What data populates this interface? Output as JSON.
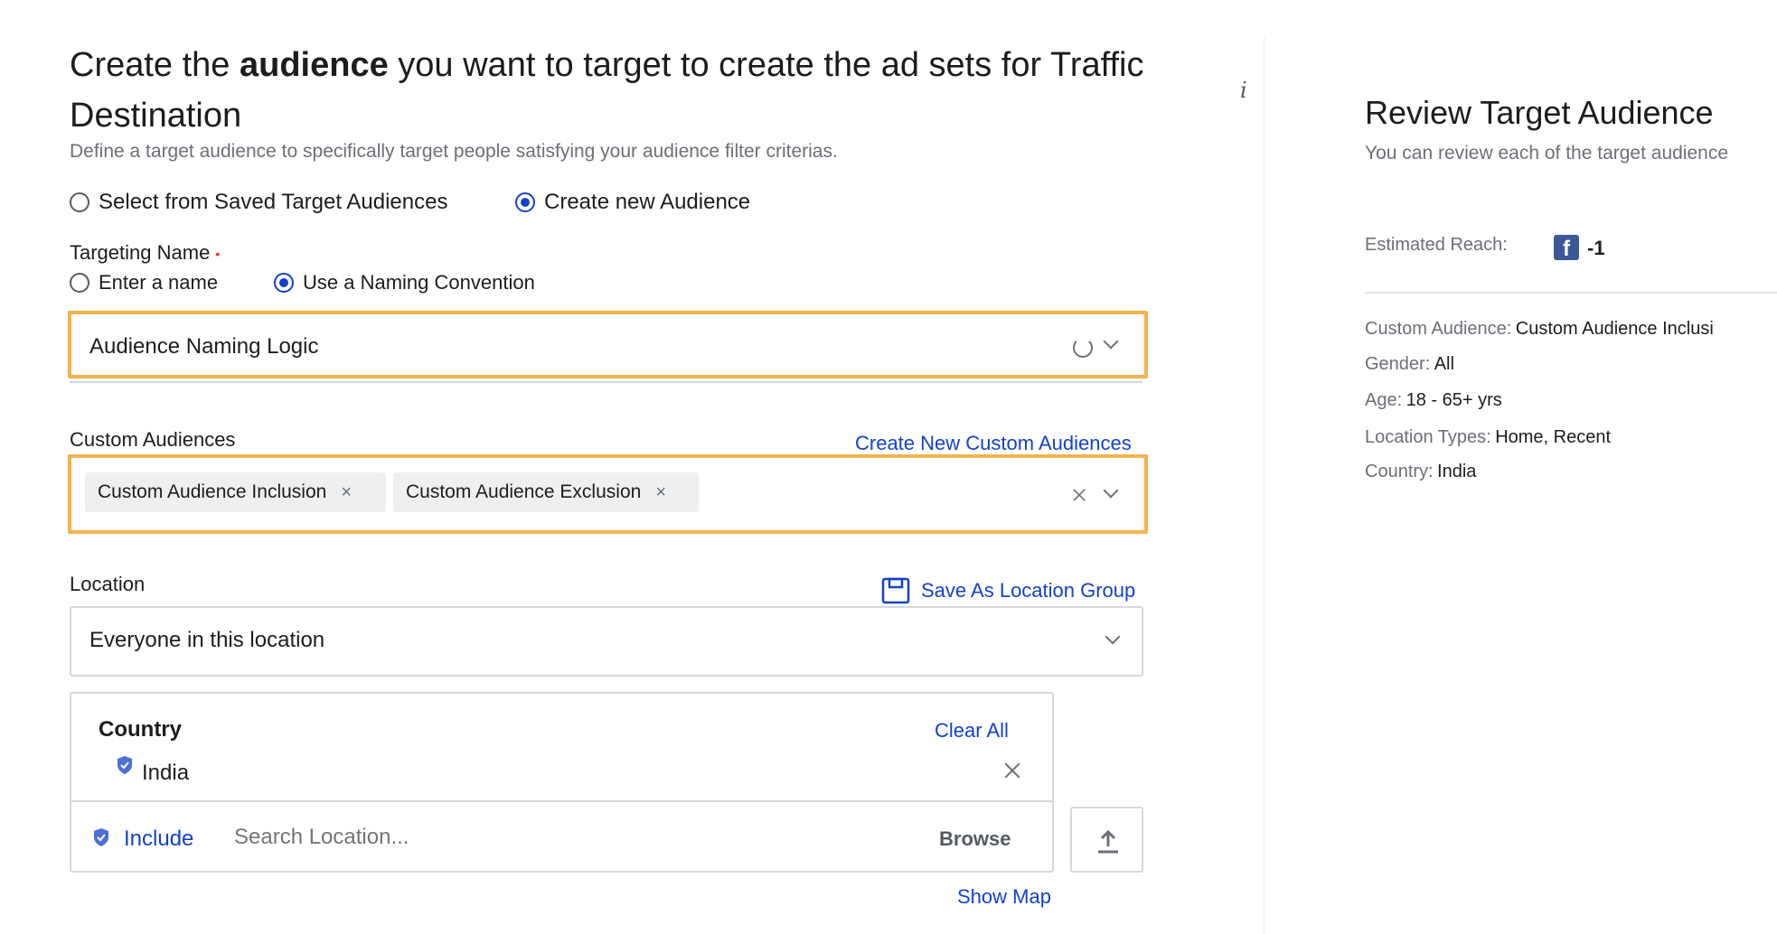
{
  "header": {
    "title_pre": "Create the ",
    "title_bold": "audience",
    "title_post": " you want to target to create the ad sets for Traffic Destination",
    "subtitle": "Define a target audience to specifically target people satisfying your audience filter criterias."
  },
  "audience_source": {
    "options": [
      "Select from Saved Target Audiences",
      "Create new Audience"
    ],
    "selected": "Create new Audience"
  },
  "targeting_name": {
    "label": "Targeting Name",
    "required_mark": "•",
    "options": [
      "Enter a name",
      "Use a Naming Convention"
    ],
    "selected": "Use a Naming Convention",
    "naming_logic_value": "Audience Naming Logic"
  },
  "custom_audiences": {
    "label": "Custom Audiences",
    "create_link": "Create New Custom Audiences",
    "chips": [
      "Custom Audience Inclusion",
      "Custom Audience Exclusion"
    ],
    "chip_remove": "×"
  },
  "location": {
    "label": "Location",
    "save_link": "Save As Location Group",
    "type_value": "Everyone in this location",
    "country_heading": "Country",
    "clear_all": "Clear All",
    "selected_country": "India",
    "include_label": "Include",
    "search_placeholder": "Search Location...",
    "browse_label": "Browse",
    "show_map": "Show Map"
  },
  "review": {
    "title": "Review Target Audience",
    "subtitle": "You can review each of the target audience",
    "estimated_reach_label": "Estimated Reach:",
    "estimated_reach_value": "-1",
    "details": [
      {
        "label": "Custom Audience:",
        "value": "Custom Audience Inclusi"
      },
      {
        "label": "Gender:",
        "value": "All"
      },
      {
        "label": "Age:",
        "value": "18 - 65+ yrs"
      },
      {
        "label": "Location Types:",
        "value": "Home, Recent"
      },
      {
        "label": "Country:",
        "value": "India"
      }
    ]
  },
  "colors": {
    "accent": "#1442c6",
    "highlight": "#f0b44c",
    "required": "#e03131",
    "facebook": "#3b5998"
  },
  "icons": {
    "info": "i",
    "facebook": "f"
  }
}
